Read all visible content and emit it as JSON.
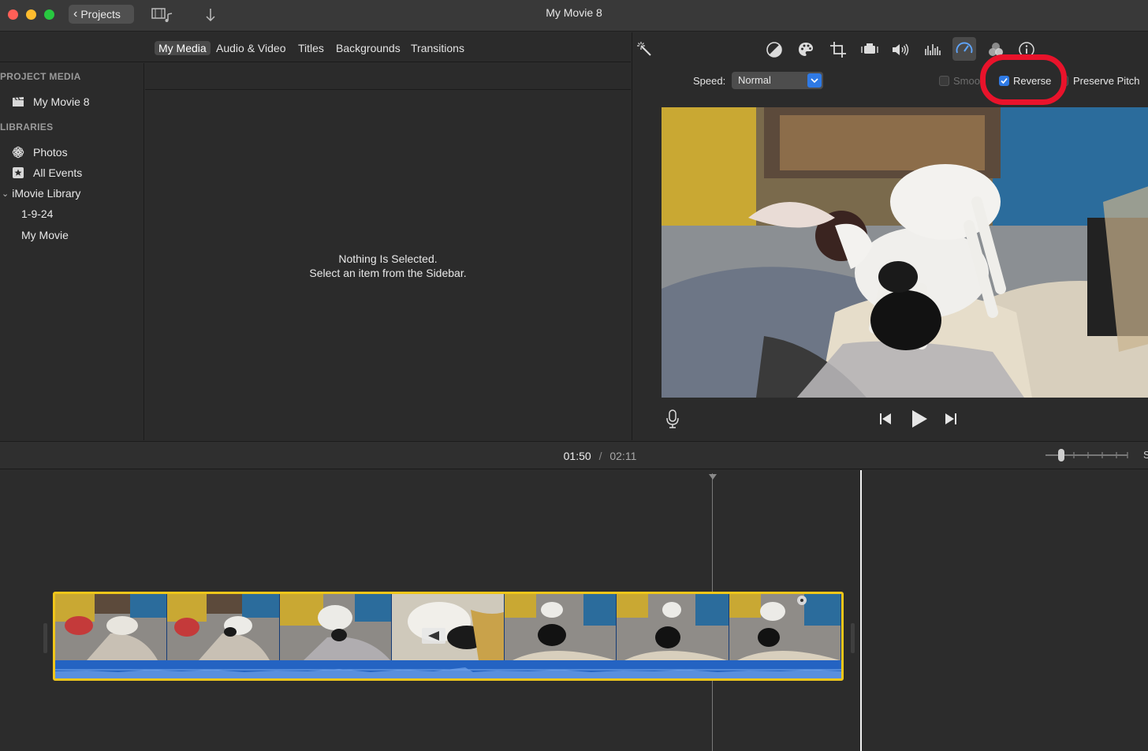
{
  "titlebar": {
    "window_title": "My Movie 8",
    "back_label": "Projects",
    "colors": {
      "close": "#fe5f57",
      "minimize": "#febc2e",
      "zoom": "#28c840"
    }
  },
  "browser_tabs": [
    {
      "label": "My Media",
      "active": true
    },
    {
      "label": "Audio & Video",
      "active": false
    },
    {
      "label": "Titles",
      "active": false
    },
    {
      "label": "Backgrounds",
      "active": false
    },
    {
      "label": "Transitions",
      "active": false
    }
  ],
  "sidebar": {
    "project_media_heading": "PROJECT MEDIA",
    "project_item": "My Movie 8",
    "libraries_heading": "LIBRARIES",
    "photos": "Photos",
    "all_events": "All Events",
    "library": "iMovie Library",
    "events": [
      "1-9-24",
      "My Movie"
    ]
  },
  "media_browser": {
    "empty_title": "Nothing Is Selected.",
    "empty_hint": "Select an item from the Sidebar."
  },
  "viewer": {
    "toolbar_icons": [
      "magic-wand-icon",
      "color-balance-icon",
      "color-palette-icon",
      "crop-icon",
      "stabilization-icon",
      "volume-icon",
      "equalizer-icon",
      "speed-icon",
      "filter-icon",
      "info-icon"
    ],
    "speed_label": "Speed:",
    "speed_value": "Normal",
    "smooth_label": "Smoo",
    "reverse_label": "Reverse",
    "reverse_checked": true,
    "preserve_pitch_label": "Preserve Pitch",
    "accent": "#2f7ae5",
    "highlight_color": "#e9132b"
  },
  "timeline": {
    "current_time": "01:50",
    "separator": "/",
    "total_time": "02:11"
  }
}
